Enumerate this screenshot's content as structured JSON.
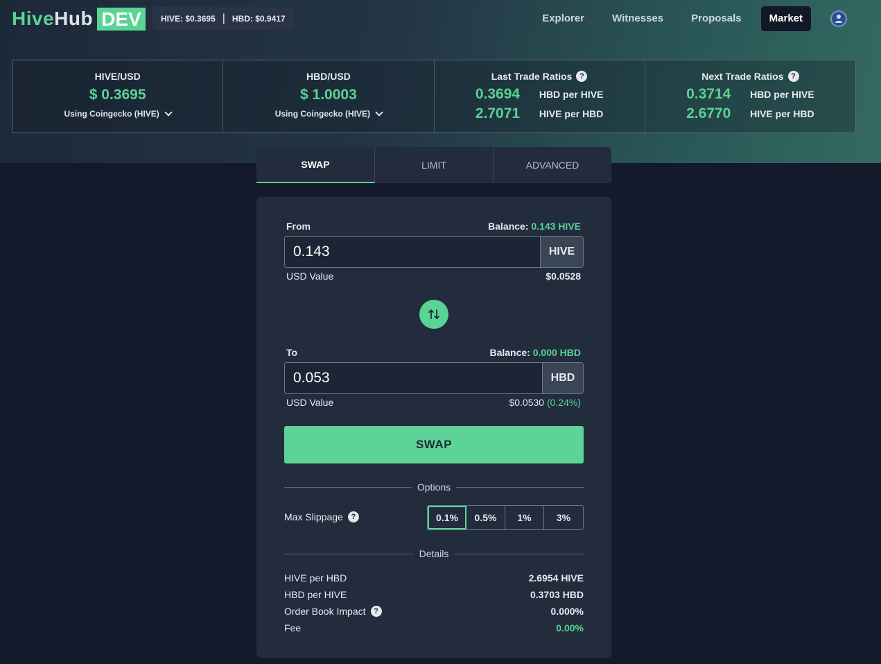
{
  "header": {
    "logo_part1": "Hive",
    "logo_part2": "Hub",
    "logo_badge": "DEV",
    "hive_price_label": "HIVE:",
    "hive_price": "$0.3695",
    "hbd_price_label": "HBD:",
    "hbd_price": "$0.9417",
    "nav": [
      "Explorer",
      "Witnesses",
      "Proposals",
      "Market"
    ],
    "active_nav": "Market"
  },
  "ticker": {
    "hive_usd": {
      "label": "HIVE/USD",
      "value": "$ 0.3695",
      "source": "Using Coingecko (HIVE)"
    },
    "hbd_usd": {
      "label": "HBD/USD",
      "value": "$ 1.0003",
      "source": "Using Coingecko (HIVE)"
    },
    "last_trade": {
      "label": "Last Trade Ratios",
      "rows": [
        {
          "value": "0.3694",
          "unit": "HBD per HIVE"
        },
        {
          "value": "2.7071",
          "unit": "HIVE per HBD"
        }
      ]
    },
    "next_trade": {
      "label": "Next Trade Ratios",
      "rows": [
        {
          "value": "0.3714",
          "unit": "HBD per HIVE"
        },
        {
          "value": "2.6770",
          "unit": "HIVE per HBD"
        }
      ]
    }
  },
  "tabs": [
    "SWAP",
    "LIMIT",
    "ADVANCED"
  ],
  "active_tab": "SWAP",
  "swap": {
    "from_label": "From",
    "from_balance_label": "Balance:",
    "from_balance": "0.143 HIVE",
    "from_value": "0.143",
    "from_unit": "HIVE",
    "from_usd_label": "USD Value",
    "from_usd": "$0.0528",
    "to_label": "To",
    "to_balance_label": "Balance:",
    "to_balance": "0.000 HBD",
    "to_value": "0.053",
    "to_unit": "HBD",
    "to_usd_label": "USD Value",
    "to_usd": "$0.0530",
    "to_usd_diff": "(0.24%)",
    "swap_button": "SWAP"
  },
  "options": {
    "title": "Options",
    "slippage_label": "Max Slippage",
    "slippage_options": [
      "0.1%",
      "0.5%",
      "1%",
      "3%"
    ],
    "slippage_selected": "0.1%"
  },
  "details": {
    "title": "Details",
    "rows": [
      {
        "key": "HIVE per HBD",
        "value": "2.6954 HIVE"
      },
      {
        "key": "HBD per HIVE",
        "value": "0.3703 HBD"
      },
      {
        "key": "Order Book Impact",
        "value": "0.000%"
      },
      {
        "key": "Fee",
        "value": "0.00%"
      }
    ]
  },
  "colors": {
    "accent": "#5ad394",
    "panel": "#222c3d",
    "background": "#141a2b"
  },
  "icons": [
    "help-icon",
    "chevron-down-icon",
    "swap-direction-icon",
    "avatar"
  ]
}
